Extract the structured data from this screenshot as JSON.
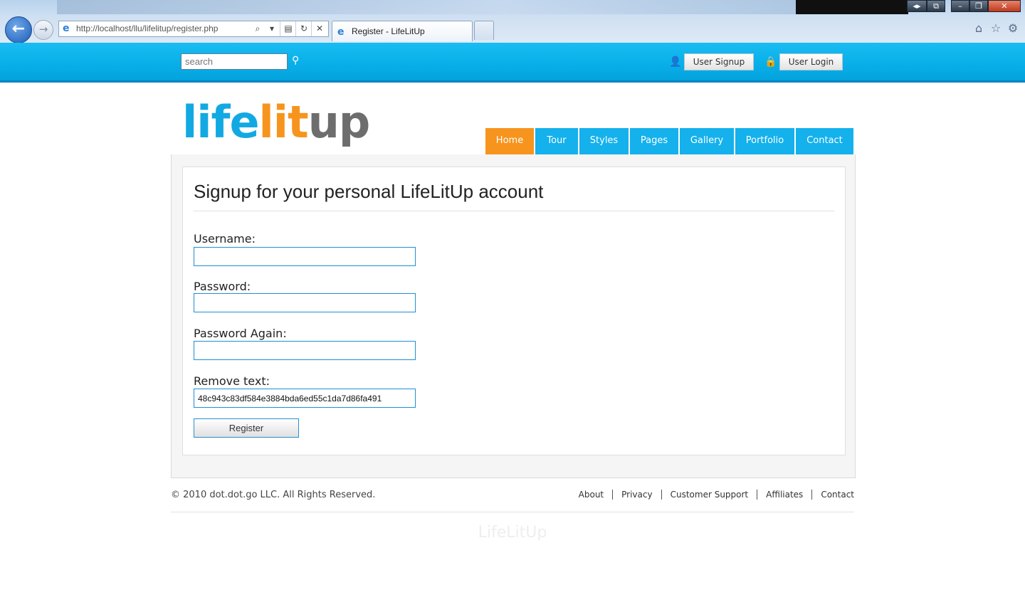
{
  "browser": {
    "url": "http://localhost/llu/lifelitup/register.php",
    "tab_title": "Register - LifeLitUp",
    "icons": [
      "back-arrow-icon",
      "forward-arrow-icon",
      "ie-icon",
      "search-icon",
      "dropdown-icon",
      "compat-icon",
      "refresh-icon",
      "close-icon",
      "home-icon",
      "star-icon",
      "gear-icon"
    ]
  },
  "header": {
    "search_placeholder": "search",
    "signup_label": "User Signup",
    "login_label": "User Login"
  },
  "logo": {
    "part1": "life",
    "part2": "lit",
    "part3": "up"
  },
  "nav": {
    "items": [
      {
        "label": "Home",
        "active": true
      },
      {
        "label": "Tour"
      },
      {
        "label": "Styles"
      },
      {
        "label": "Pages"
      },
      {
        "label": "Gallery"
      },
      {
        "label": "Portfolio"
      },
      {
        "label": "Contact"
      }
    ]
  },
  "form": {
    "heading": "Signup for your personal LifeLitUp account",
    "username_label": "Username:",
    "username_value": "",
    "password_label": "Password:",
    "password_value": "",
    "password_again_label": "Password Again:",
    "password_again_value": "",
    "remove_text_label": "Remove text:",
    "remove_text_value": "48c943c83df584e3884bda6ed55c1da7d86fa491",
    "submit_label": "Register"
  },
  "footer": {
    "copyright": "© 2010 dot.dot.go LLC. All Rights Reserved.",
    "links": [
      "About",
      "Privacy",
      "Customer Support",
      "Affiliates",
      "Contact"
    ],
    "watermark": "LifeLitUp"
  },
  "colors": {
    "topbar": "#08aee8",
    "nav_item": "#14b1ec",
    "nav_active": "#f7941d",
    "logo_blue": "#12a9e3",
    "logo_orange": "#f7941d",
    "logo_gray": "#6d6d6d",
    "input_border": "#1f8fd0"
  }
}
